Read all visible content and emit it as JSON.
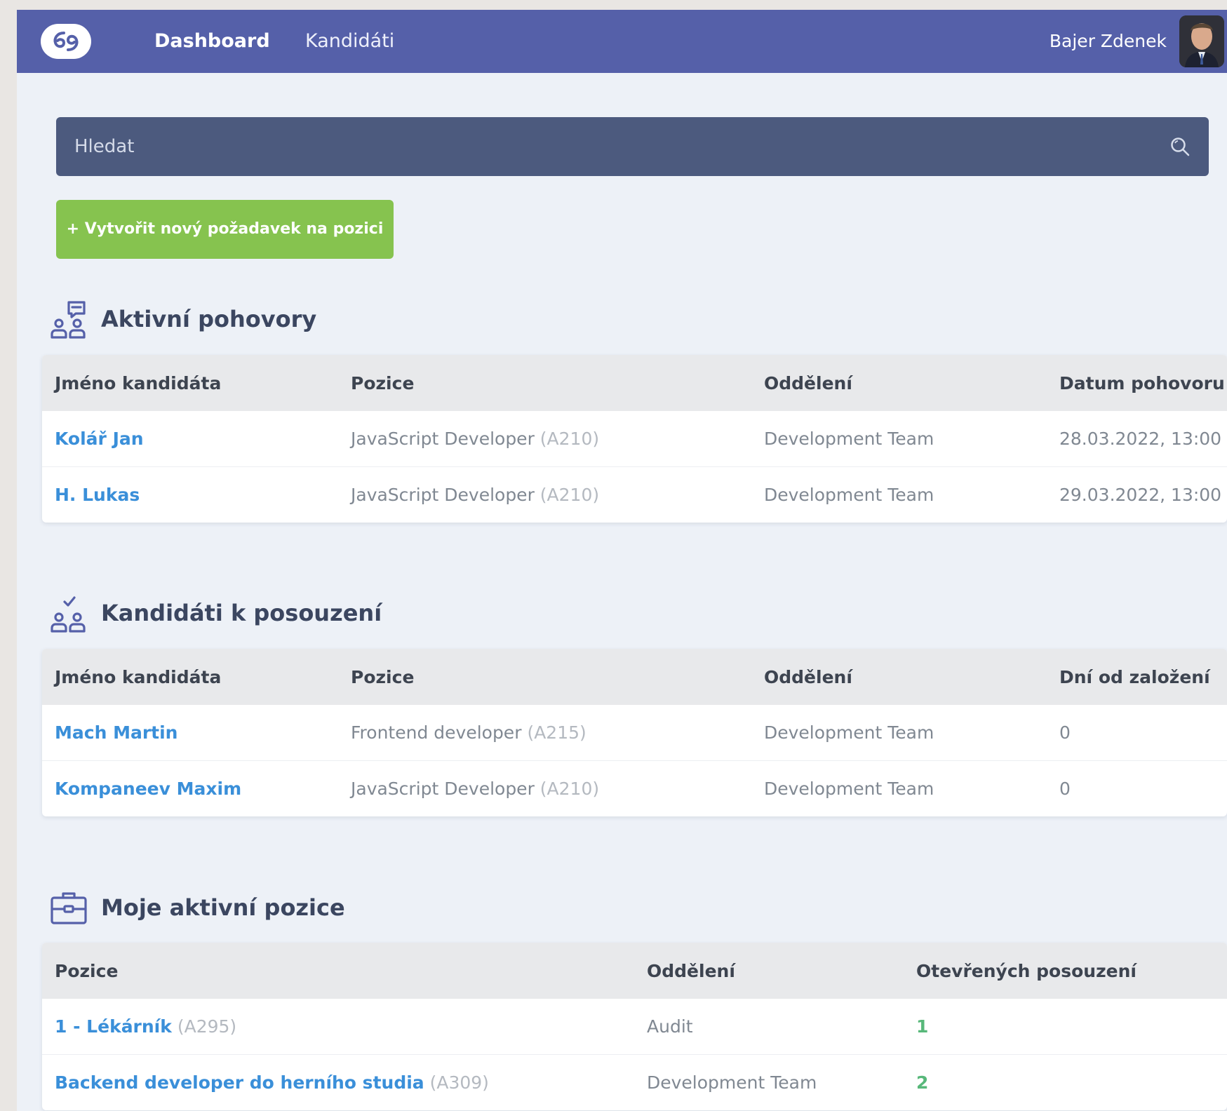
{
  "nav": {
    "items": [
      "Dashboard",
      "Kandidáti"
    ],
    "user_name": "Bajer Zdenek"
  },
  "search": {
    "placeholder": "Hledat"
  },
  "create_button": "+ Vytvořit nový požadavek na pozici",
  "interviews": {
    "title": "Aktivní pohovory",
    "headers": [
      "Jméno kandidáta",
      "Pozice",
      "Oddělení",
      "Datum pohovoru"
    ],
    "rows": [
      {
        "name": "Kolář Jan",
        "position": "JavaScript Developer",
        "code": "(A210)",
        "department": "Development Team",
        "date": "28.03.2022, 13:00"
      },
      {
        "name": "H. Lukas",
        "position": "JavaScript Developer",
        "code": "(A210)",
        "department": "Development Team",
        "date": "29.03.2022, 13:00"
      }
    ]
  },
  "review": {
    "title": "Kandidáti k posouzení",
    "headers": [
      "Jméno kandidáta",
      "Pozice",
      "Oddělení",
      "Dní od založení"
    ],
    "rows": [
      {
        "name": "Mach Martin",
        "position": "Frontend developer",
        "code": "(A215)",
        "department": "Development Team",
        "days": "0"
      },
      {
        "name": "Kompaneev Maxim",
        "position": "JavaScript Developer",
        "code": "(A210)",
        "department": "Development Team",
        "days": "0"
      }
    ]
  },
  "positions": {
    "title": "Moje aktivní pozice",
    "headers": [
      "Pozice",
      "Oddělení",
      "Otevřených posouzení"
    ],
    "rows": [
      {
        "name": "1 - Lékárník",
        "code": "(A295)",
        "department": "Audit",
        "open": "1"
      },
      {
        "name": "Backend developer do herního studia",
        "code": "(A309)",
        "department": "Development Team",
        "open": "2"
      }
    ]
  },
  "colors": {
    "topbar": "#5560a9",
    "search_bg": "#4c5a7e",
    "create_button": "#86c34f",
    "link": "#3a8fd9",
    "count": "#58b87a"
  },
  "icons": [
    "logo-icon",
    "search-icon",
    "interview-icon",
    "candidates-check-icon",
    "briefcase-icon"
  ]
}
